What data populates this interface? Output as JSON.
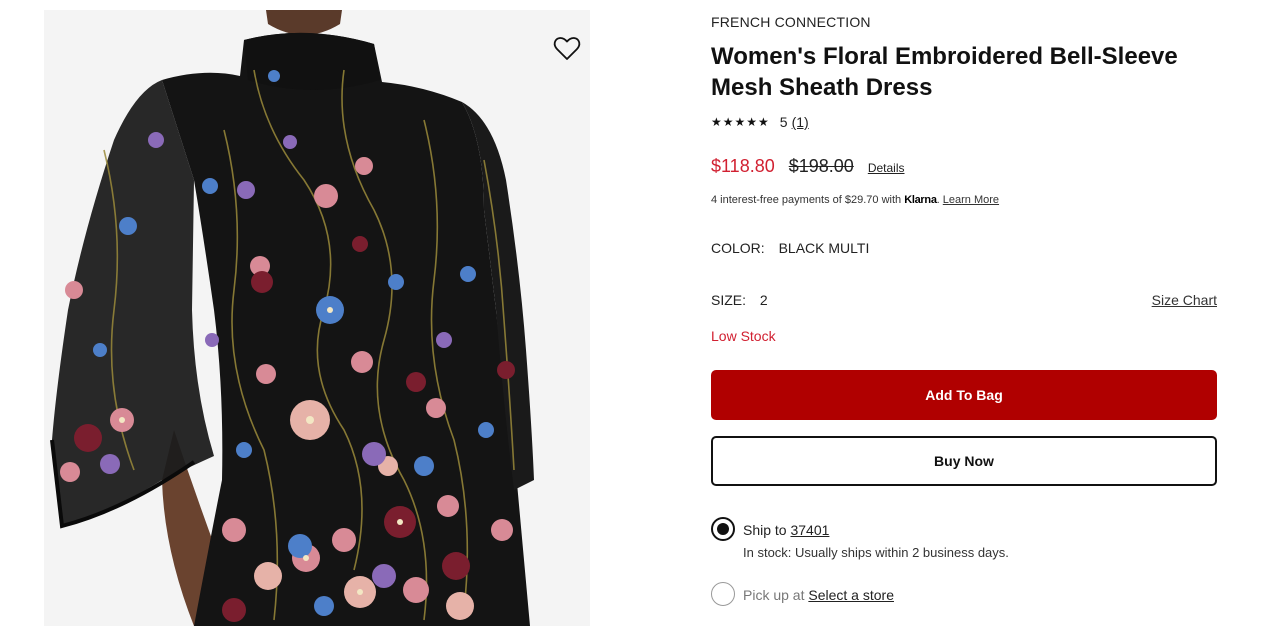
{
  "product": {
    "brand": "FRENCH CONNECTION",
    "title": "Women's Floral Embroidered Bell-Sleeve Mesh Sheath Dress",
    "rating": {
      "stars": "★★★★★",
      "score": "5",
      "review_count": "(1)"
    },
    "price": {
      "sale": "$118.80",
      "original": "$198.00",
      "details_label": "Details"
    },
    "klarna": {
      "text_before": "4 interest-free payments of $29.70 with ",
      "logo": "Klarna",
      "separator": ".",
      "learn_more": "Learn More"
    },
    "color": {
      "label": "COLOR:",
      "value": "BLACK MULTI"
    },
    "size": {
      "label": "SIZE:",
      "value": "2",
      "chart_label": "Size Chart"
    },
    "stock_warning": "Low Stock",
    "buttons": {
      "add_to_bag": "Add To Bag",
      "buy_now": "Buy Now"
    },
    "fulfillment": {
      "ship": {
        "label": "Ship to ",
        "zip": "37401",
        "note": "In stock: Usually ships within 2 business days.",
        "selected": true
      },
      "pickup": {
        "label": "Pick up at ",
        "store_link": "Select a store",
        "selected": false
      }
    }
  },
  "colors": {
    "sale_red": "#d12031",
    "add_to_bag_bg": "#b00000",
    "image_bg": "#f5f5f5",
    "dress_black": "#141414"
  },
  "icons": {
    "favorite": "heart-outline-icon"
  }
}
